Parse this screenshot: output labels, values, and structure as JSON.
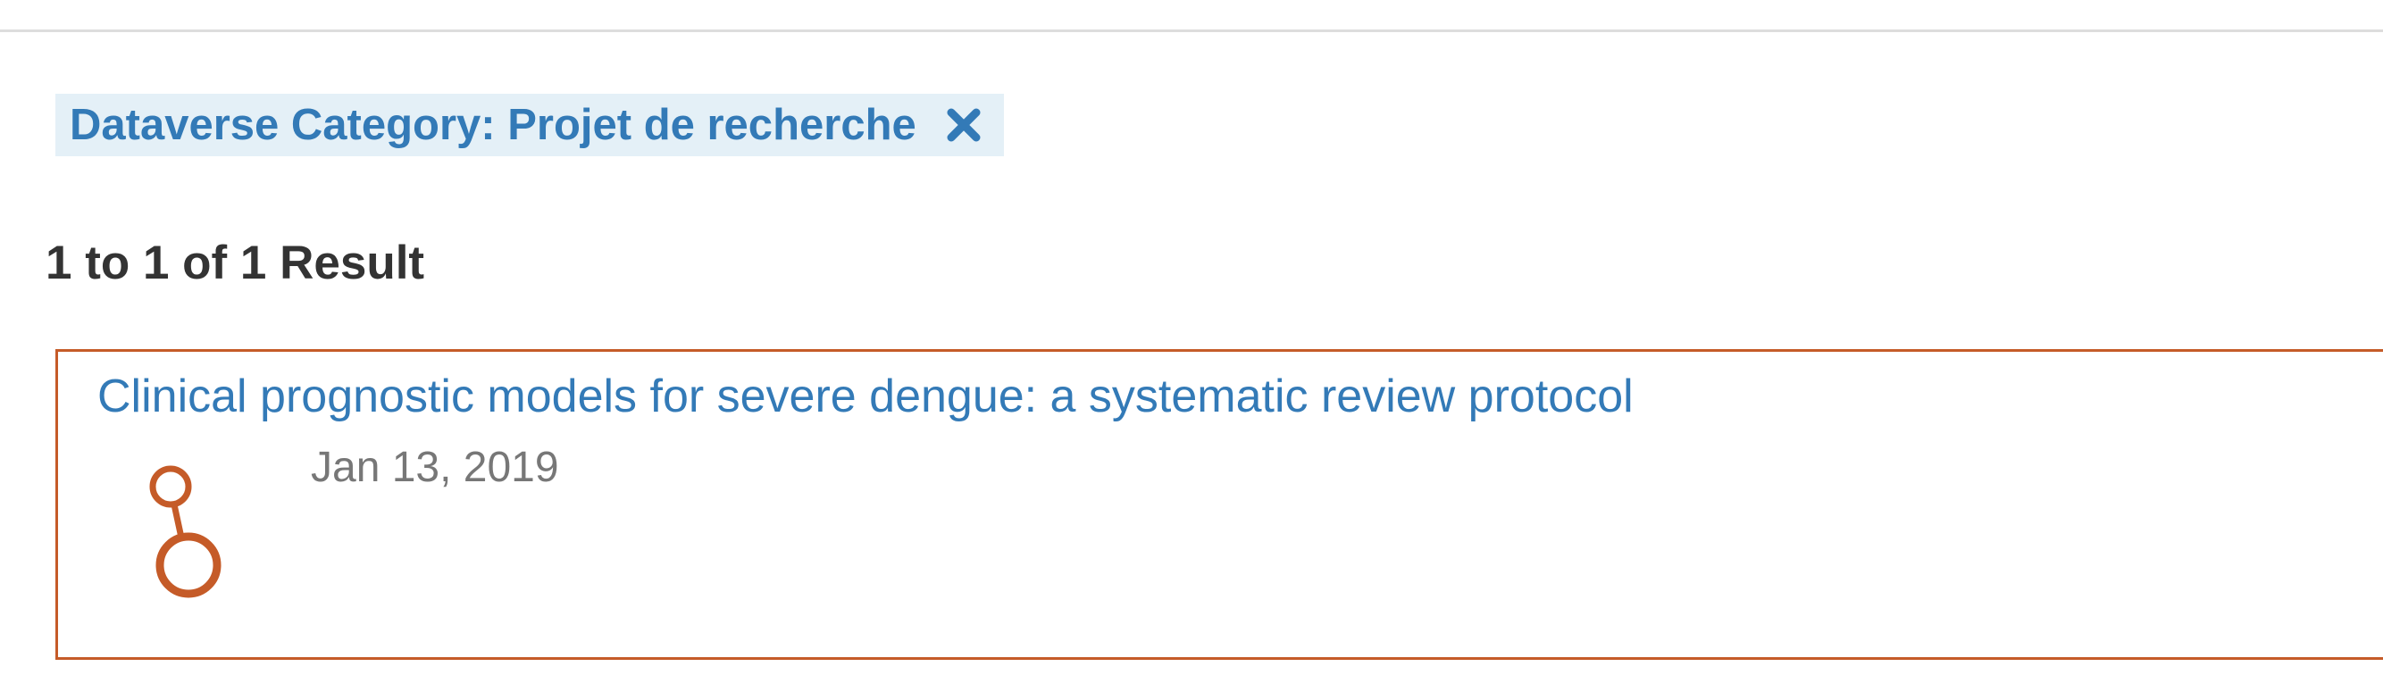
{
  "facet_filter": {
    "label": "Dataverse Category: Projet de recherche",
    "remove_icon": "close-icon"
  },
  "results": {
    "summary": "1 to 1 of 1 Result",
    "items": [
      {
        "title": "Clinical prognostic models for severe dengue: a systematic review protocol",
        "date": "Jan 13, 2019",
        "icon": "dataset-icon"
      }
    ]
  },
  "colors": {
    "link": "#337ab7",
    "dataset_accent": "#c55b28",
    "facet_background": "#e4f0f7",
    "date_text": "#777777"
  }
}
